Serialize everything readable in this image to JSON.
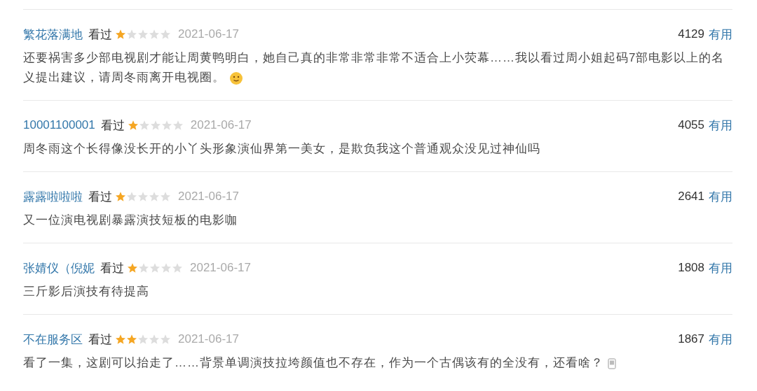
{
  "comments": [
    {
      "user": "繁花落满地",
      "status": "看过",
      "stars": 1,
      "date": "2021-06-17",
      "votes": "4129",
      "vote_label": "有用",
      "text": "还要祸害多少部电视剧才能让周黄鸭明白，她自己真的非常非常非常不适合上小荧幕……我以看过周小姐起码7部电影以上的名义提出建议，请周冬雨离开电视圈。",
      "kind": "emoji"
    },
    {
      "user": "10001100001",
      "status": "看过",
      "stars": 1,
      "date": "2021-06-17",
      "votes": "4055",
      "vote_label": "有用",
      "text": "周冬雨这个长得像没长开的小丫头形象演仙界第一美女，是欺负我这个普通观众没见过神仙吗"
    },
    {
      "user": "露露啦啦啦",
      "status": "看过",
      "stars": 1,
      "date": "2021-06-17",
      "votes": "2641",
      "vote_label": "有用",
      "text": "又一位演电视剧暴露演技短板的电影咖"
    },
    {
      "user": "张婧仪（倪妮",
      "status": "看过",
      "stars": 1,
      "date": "2021-06-17",
      "votes": "1808",
      "vote_label": "有用",
      "text": "三斤影后演技有待提高"
    },
    {
      "user": "不在服务区",
      "status": "看过",
      "stars": 2,
      "date": "2021-06-17",
      "votes": "1867",
      "vote_label": "有用",
      "text": "看了一集，这剧可以抬走了……背景单调演技拉垮颜值也不存在，作为一个古偶该有的全没有，还看啥？",
      "kind": "attachment"
    }
  ]
}
